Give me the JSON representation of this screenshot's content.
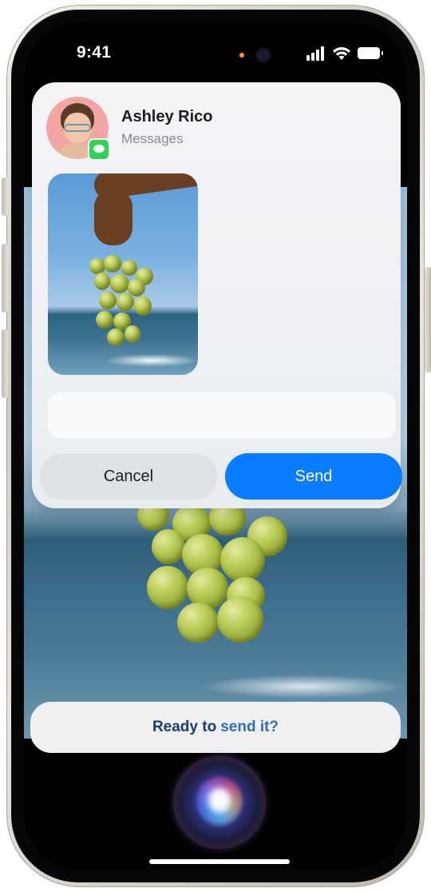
{
  "status_bar": {
    "time": "9:41"
  },
  "card": {
    "contact_name": "Ashley Rico",
    "app_name": "Messages",
    "attachment_icon": "photo-thumbnail",
    "message_input": {
      "value": "",
      "placeholder": ""
    },
    "cancel_label": "Cancel",
    "send_label": "Send"
  },
  "siri": {
    "prompt_part1": "Ready to",
    "prompt_part2": "send it?"
  },
  "colors": {
    "send_button": "#0a7cff",
    "cancel_button": "#dfe2e4",
    "messages_badge": "#2fd256"
  }
}
